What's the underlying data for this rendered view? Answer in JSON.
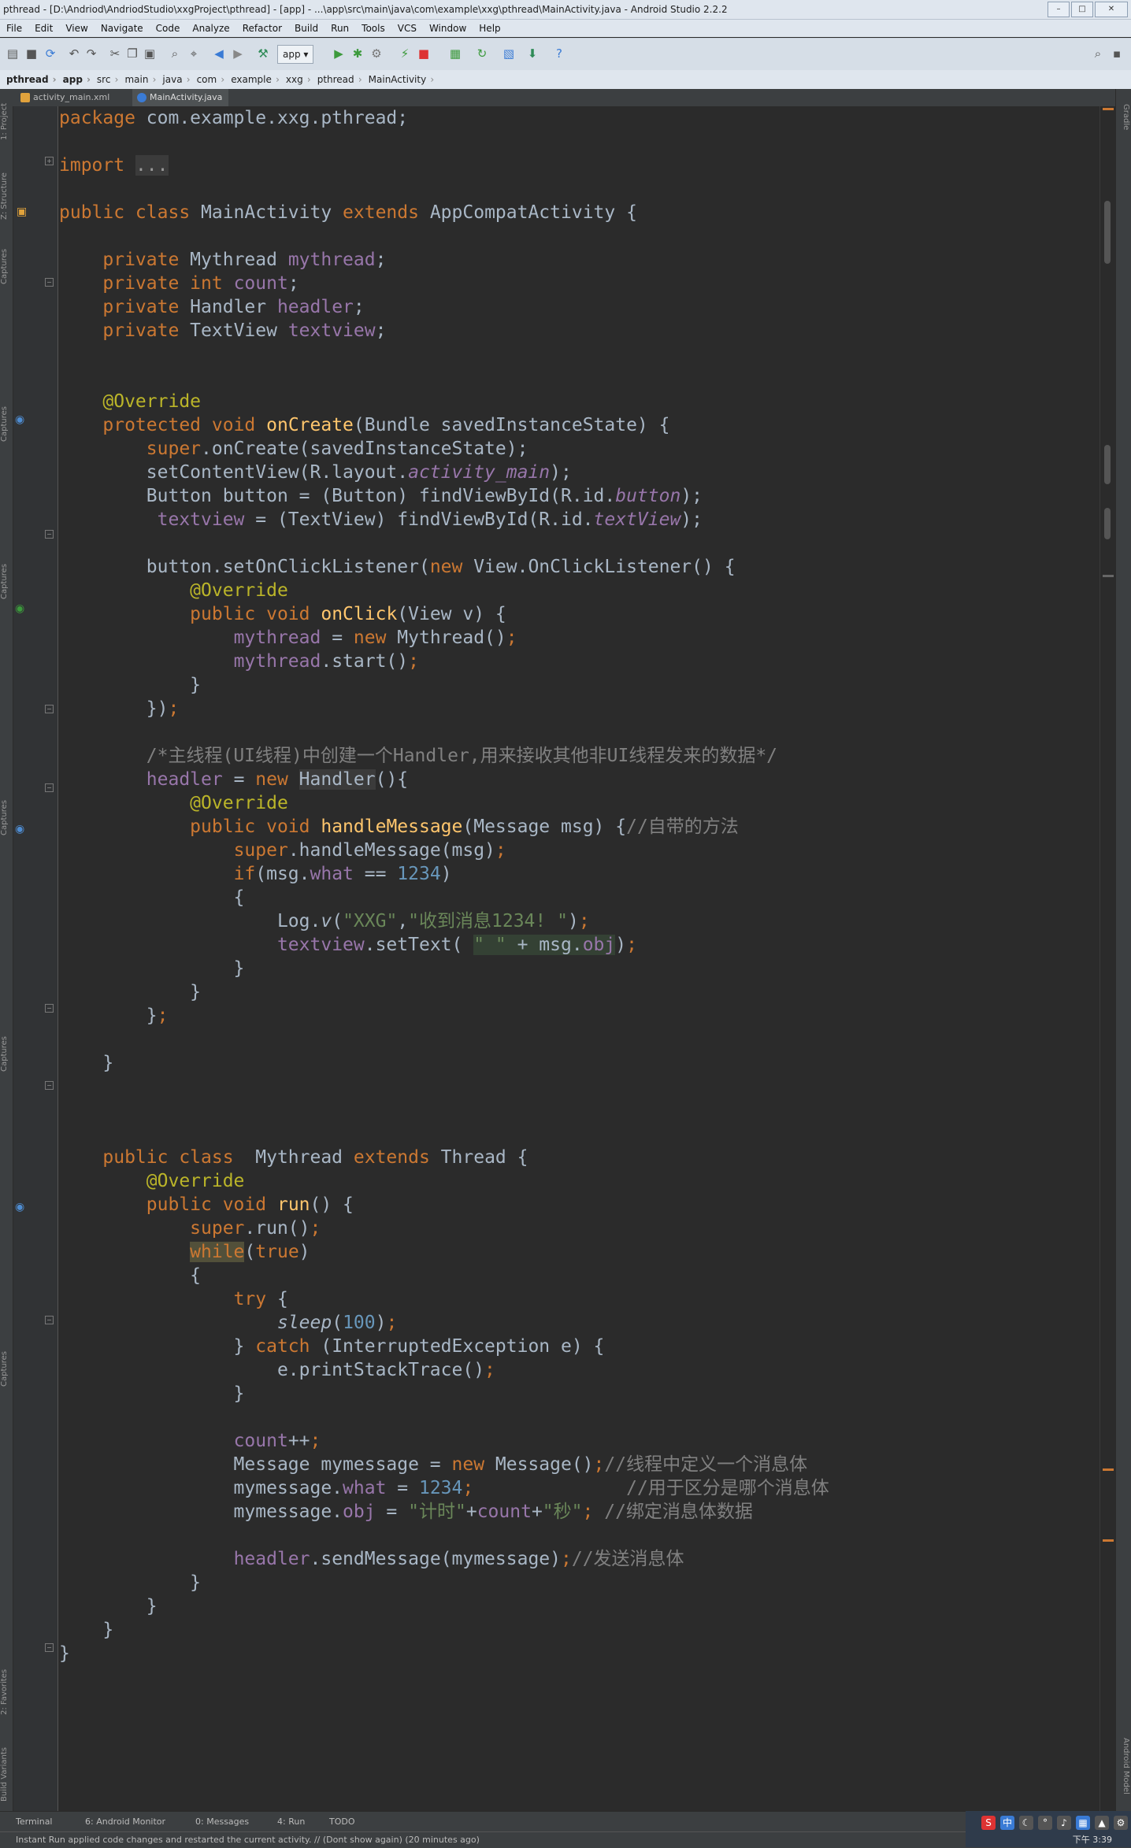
{
  "window": {
    "title": "pthread - [D:\\Andriod\\AndriodStudio\\xxgProject\\pthread] - [app] - ...\\app\\src\\main\\java\\com\\example\\xxg\\pthread\\MainActivity.java - Android Studio 2.2.2",
    "minimize": "–",
    "maximize": "□",
    "close": "✕"
  },
  "menu": [
    "File",
    "Edit",
    "View",
    "Navigate",
    "Code",
    "Analyze",
    "Refactor",
    "Build",
    "Run",
    "Tools",
    "VCS",
    "Window",
    "Help"
  ],
  "toolbar": {
    "run_config": "app ▾"
  },
  "breadcrumbs": [
    "pthread",
    "app",
    "src",
    "main",
    "java",
    "com",
    "example",
    "xxg",
    "pthread",
    "MainActivity"
  ],
  "tabs": [
    {
      "label": "activity_main.xml",
      "active": false
    },
    {
      "label": "MainActivity.java",
      "active": true
    }
  ],
  "left_tool_windows": [
    "1: Project",
    "Z: Structure",
    "Captures",
    "Captures",
    "Captures",
    "Captures",
    "Captures",
    "Captures",
    "2: Favorites",
    "Build Variants"
  ],
  "right_tool_windows": [
    "Gradle",
    "Android Model"
  ],
  "code_lines": [
    "package com.example.xxg.pthread;",
    "",
    "import ...",
    "",
    "public class MainActivity extends AppCompatActivity {",
    "",
    "    private Mythread mythread;",
    "    private int count;",
    "    private Handler headler;",
    "    private TextView textview;",
    "",
    "",
    "    @Override",
    "    protected void onCreate(Bundle savedInstanceState) {",
    "        super.onCreate(savedInstanceState);",
    "        setContentView(R.layout.activity_main);",
    "        Button button = (Button) findViewById(R.id.button);",
    "         textview = (TextView) findViewById(R.id.textView);",
    "",
    "        button.setOnClickListener(new View.OnClickListener() {",
    "            @Override",
    "            public void onClick(View v) {",
    "                mythread = new Mythread();",
    "                mythread.start();",
    "            }",
    "        });",
    "",
    "        /*主线程(UI线程)中创建一个Handler,用来接收其他非UI线程发来的数据*/",
    "        headler = new Handler(){",
    "            @Override",
    "            public void handleMessage(Message msg) {//自带的方法",
    "                super.handleMessage(msg);",
    "                if(msg.what == 1234)",
    "                {",
    "                    Log.v(\"XXG\",\"收到消息1234! \");",
    "                    textview.setText( \" \" + msg.obj);",
    "                }",
    "            }",
    "        };",
    "",
    "    }",
    "",
    "",
    "",
    "    public class  Mythread extends Thread {",
    "        @Override",
    "        public void run() {",
    "            super.run();",
    "            while(true)",
    "            {",
    "                try {",
    "                    sleep(100);",
    "                } catch (InterruptedException e) {",
    "                    e.printStackTrace();",
    "                }",
    "",
    "                count++;",
    "                Message mymessage = new Message();//线程中定义一个消息体",
    "                mymessage.what = 1234;              //用于区分是哪个消息体",
    "                mymessage.obj = \"计时\"+count+\"秒\"; //绑定消息体数据",
    "",
    "                headler.sendMessage(mymessage);//发送消息体",
    "            }",
    "        }",
    "    }",
    "}"
  ],
  "bottom_tools": [
    "Terminal",
    "6: Android Monitor",
    "0: Messages",
    "4: Run",
    "TODO"
  ],
  "status": "Instant Run applied code changes and restarted the current activity. // (Dont show again) (20 minutes ago)",
  "tray": {
    "clock": "下午 3:39"
  }
}
